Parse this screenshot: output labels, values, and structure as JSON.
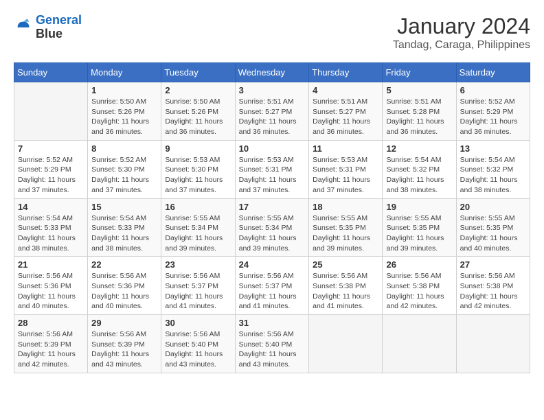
{
  "app": {
    "name": "GeneralBlue",
    "logo_text1": "General",
    "logo_text2": "Blue"
  },
  "title": "January 2024",
  "subtitle": "Tandag, Caraga, Philippines",
  "header": {
    "days": [
      "Sunday",
      "Monday",
      "Tuesday",
      "Wednesday",
      "Thursday",
      "Friday",
      "Saturday"
    ]
  },
  "weeks": [
    [
      {
        "day": "",
        "info": ""
      },
      {
        "day": "1",
        "info": "Sunrise: 5:50 AM\nSunset: 5:26 PM\nDaylight: 11 hours and 36 minutes."
      },
      {
        "day": "2",
        "info": "Sunrise: 5:50 AM\nSunset: 5:26 PM\nDaylight: 11 hours and 36 minutes."
      },
      {
        "day": "3",
        "info": "Sunrise: 5:51 AM\nSunset: 5:27 PM\nDaylight: 11 hours and 36 minutes."
      },
      {
        "day": "4",
        "info": "Sunrise: 5:51 AM\nSunset: 5:27 PM\nDaylight: 11 hours and 36 minutes."
      },
      {
        "day": "5",
        "info": "Sunrise: 5:51 AM\nSunset: 5:28 PM\nDaylight: 11 hours and 36 minutes."
      },
      {
        "day": "6",
        "info": "Sunrise: 5:52 AM\nSunset: 5:29 PM\nDaylight: 11 hours and 36 minutes."
      }
    ],
    [
      {
        "day": "7",
        "info": "Sunrise: 5:52 AM\nSunset: 5:29 PM\nDaylight: 11 hours and 37 minutes."
      },
      {
        "day": "8",
        "info": "Sunrise: 5:52 AM\nSunset: 5:30 PM\nDaylight: 11 hours and 37 minutes."
      },
      {
        "day": "9",
        "info": "Sunrise: 5:53 AM\nSunset: 5:30 PM\nDaylight: 11 hours and 37 minutes."
      },
      {
        "day": "10",
        "info": "Sunrise: 5:53 AM\nSunset: 5:31 PM\nDaylight: 11 hours and 37 minutes."
      },
      {
        "day": "11",
        "info": "Sunrise: 5:53 AM\nSunset: 5:31 PM\nDaylight: 11 hours and 37 minutes."
      },
      {
        "day": "12",
        "info": "Sunrise: 5:54 AM\nSunset: 5:32 PM\nDaylight: 11 hours and 38 minutes."
      },
      {
        "day": "13",
        "info": "Sunrise: 5:54 AM\nSunset: 5:32 PM\nDaylight: 11 hours and 38 minutes."
      }
    ],
    [
      {
        "day": "14",
        "info": "Sunrise: 5:54 AM\nSunset: 5:33 PM\nDaylight: 11 hours and 38 minutes."
      },
      {
        "day": "15",
        "info": "Sunrise: 5:54 AM\nSunset: 5:33 PM\nDaylight: 11 hours and 38 minutes."
      },
      {
        "day": "16",
        "info": "Sunrise: 5:55 AM\nSunset: 5:34 PM\nDaylight: 11 hours and 39 minutes."
      },
      {
        "day": "17",
        "info": "Sunrise: 5:55 AM\nSunset: 5:34 PM\nDaylight: 11 hours and 39 minutes."
      },
      {
        "day": "18",
        "info": "Sunrise: 5:55 AM\nSunset: 5:35 PM\nDaylight: 11 hours and 39 minutes."
      },
      {
        "day": "19",
        "info": "Sunrise: 5:55 AM\nSunset: 5:35 PM\nDaylight: 11 hours and 39 minutes."
      },
      {
        "day": "20",
        "info": "Sunrise: 5:55 AM\nSunset: 5:35 PM\nDaylight: 11 hours and 40 minutes."
      }
    ],
    [
      {
        "day": "21",
        "info": "Sunrise: 5:56 AM\nSunset: 5:36 PM\nDaylight: 11 hours and 40 minutes."
      },
      {
        "day": "22",
        "info": "Sunrise: 5:56 AM\nSunset: 5:36 PM\nDaylight: 11 hours and 40 minutes."
      },
      {
        "day": "23",
        "info": "Sunrise: 5:56 AM\nSunset: 5:37 PM\nDaylight: 11 hours and 41 minutes."
      },
      {
        "day": "24",
        "info": "Sunrise: 5:56 AM\nSunset: 5:37 PM\nDaylight: 11 hours and 41 minutes."
      },
      {
        "day": "25",
        "info": "Sunrise: 5:56 AM\nSunset: 5:38 PM\nDaylight: 11 hours and 41 minutes."
      },
      {
        "day": "26",
        "info": "Sunrise: 5:56 AM\nSunset: 5:38 PM\nDaylight: 11 hours and 42 minutes."
      },
      {
        "day": "27",
        "info": "Sunrise: 5:56 AM\nSunset: 5:38 PM\nDaylight: 11 hours and 42 minutes."
      }
    ],
    [
      {
        "day": "28",
        "info": "Sunrise: 5:56 AM\nSunset: 5:39 PM\nDaylight: 11 hours and 42 minutes."
      },
      {
        "day": "29",
        "info": "Sunrise: 5:56 AM\nSunset: 5:39 PM\nDaylight: 11 hours and 43 minutes."
      },
      {
        "day": "30",
        "info": "Sunrise: 5:56 AM\nSunset: 5:40 PM\nDaylight: 11 hours and 43 minutes."
      },
      {
        "day": "31",
        "info": "Sunrise: 5:56 AM\nSunset: 5:40 PM\nDaylight: 11 hours and 43 minutes."
      },
      {
        "day": "",
        "info": ""
      },
      {
        "day": "",
        "info": ""
      },
      {
        "day": "",
        "info": ""
      }
    ]
  ]
}
